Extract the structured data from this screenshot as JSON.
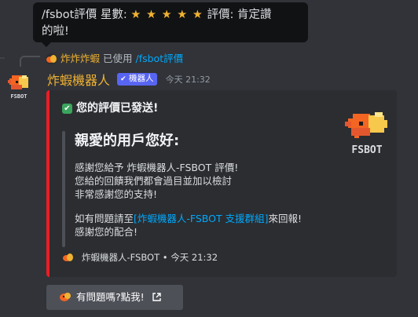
{
  "tooltip": {
    "prefix": "/fsbot評價 星數:",
    "stars": "★ ★ ★ ★ ★",
    "suffix": "評價: 肯定讚",
    "line2": "的啦!"
  },
  "reply": {
    "name": "炸炸炸蝦",
    "used": "已使用",
    "command": "/fsbot評價"
  },
  "avatar": {
    "caption": "FSBOT"
  },
  "message": {
    "author": "炸蝦機器人",
    "bot_tag": "機器人",
    "time": "今天 21:32"
  },
  "embed": {
    "accent": "#ed1c24",
    "author": "您的評價已發送!",
    "thumb_caption": "FSBOT",
    "heading": "親愛的用戶您好:",
    "body": [
      "感謝您給予 炸蝦機器人-FSBOT 評價!",
      "您給的回饋我們都會過目並加以檢討",
      "非常感謝您的支持!"
    ],
    "help_prefix": "如有問題請至",
    "help_link": "[炸蝦機器人-FSBOT 支援群組]",
    "help_suffix": "來回報!",
    "thanks": "感謝您的配合!",
    "footer": "炸蝦機器人-FSBOT • 今天 21:32"
  },
  "button": {
    "label": "有問題嗎?點我!"
  },
  "icons": [
    "check-icon",
    "external-link-icon",
    "shrimp-bot-avatar"
  ]
}
